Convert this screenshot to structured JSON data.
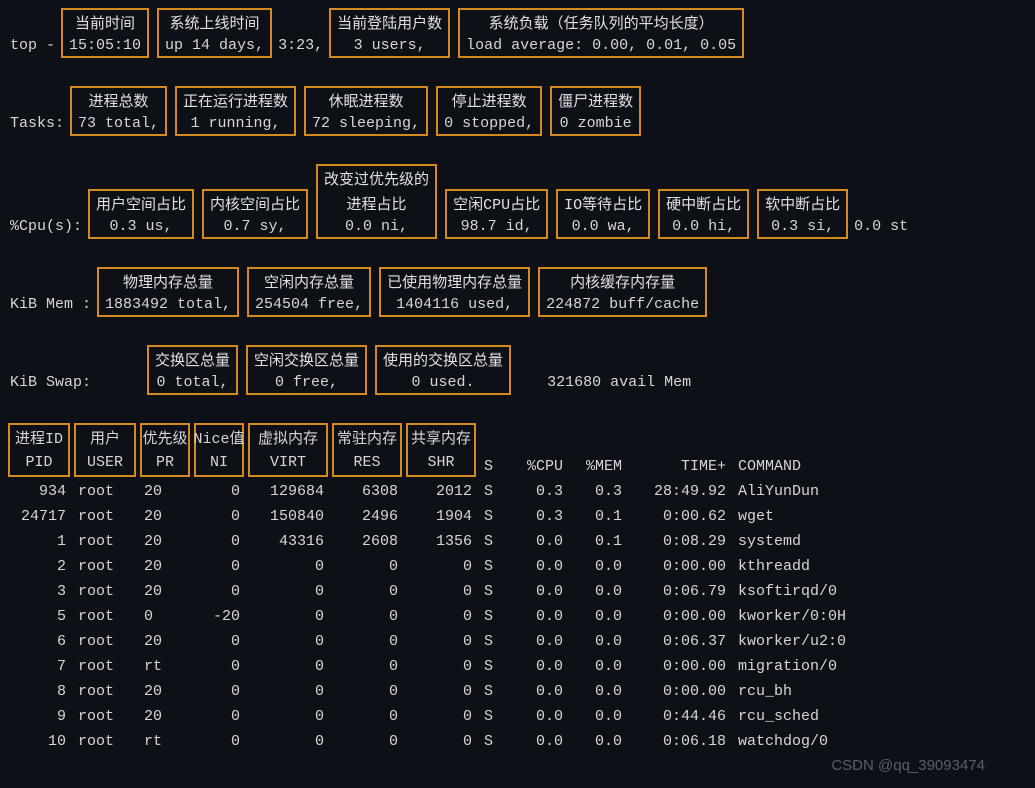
{
  "line1": {
    "prefix": "top -",
    "time_ann": "当前时间",
    "time_val": "15:05:10",
    "uptime_ann": "系统上线时间",
    "uptime_val": "up 14 days,",
    "uptime_extra": "3:23,",
    "users_ann": "当前登陆用户数",
    "users_val": "3 users,",
    "load_ann": "系统负载（任务队列的平均长度）",
    "load_val": "load average: 0.00, 0.01, 0.05"
  },
  "line2": {
    "prefix": "Tasks:",
    "total_ann": "进程总数",
    "total_val": "73 total,",
    "running_ann": "正在运行进程数",
    "running_val": "1 running,",
    "sleeping_ann": "休眠进程数",
    "sleeping_val": "72 sleeping,",
    "stopped_ann": "停止进程数",
    "stopped_val": "0 stopped,",
    "zombie_ann": "僵尸进程数",
    "zombie_val": "0 zombie"
  },
  "line3": {
    "prefix": "%Cpu(s):",
    "us_ann": "用户空间占比",
    "us_val": "0.3 us,",
    "sy_ann": "内核空间占比",
    "sy_val": "0.7 sy,",
    "ni_ann1": "改变过优先级的",
    "ni_ann2": "进程占比",
    "ni_val": "0.0 ni,",
    "id_ann": "空闲CPU占比",
    "id_val": "98.7 id,",
    "wa_ann": "IO等待占比",
    "wa_val": "0.0 wa,",
    "hi_ann": "硬中断占比",
    "hi_val": "0.0 hi,",
    "si_ann": "软中断占比",
    "si_val": "0.3 si,",
    "st_val": "0.0 st"
  },
  "line4": {
    "prefix": "KiB Mem :",
    "total_ann": "物理内存总量",
    "total_val": "1883492 total,",
    "free_ann": "空闲内存总量",
    "free_val": "254504 free,",
    "used_ann": "已使用物理内存总量",
    "used_val": "1404116 used,",
    "cache_ann": "内核缓存内存量",
    "cache_val": "224872 buff/cache"
  },
  "line5": {
    "prefix": "KiB Swap:",
    "total_ann": "交换区总量",
    "total_val": "0 total,",
    "free_ann": "空闲交换区总量",
    "free_val": "0 free,",
    "used_ann": "使用的交换区总量",
    "used_val": "0 used.",
    "avail": "321680 avail Mem"
  },
  "headers": {
    "pid_ann": "进程ID",
    "pid": "PID",
    "user_ann": "用户",
    "user": "USER",
    "pr_ann": "优先级",
    "pr": "PR",
    "ni_ann": "Nice值",
    "ni": "NI",
    "virt_ann": "虚拟内存",
    "virt": "VIRT",
    "res_ann": "常驻内存",
    "res": "RES",
    "shr_ann": "共享内存",
    "shr": "SHR",
    "s": "S",
    "cpu": "%CPU",
    "mem": "%MEM",
    "time": "TIME+",
    "cmd": "COMMAND"
  },
  "rows": [
    {
      "pid": "934",
      "user": "root",
      "pr": "20",
      "ni": "0",
      "virt": "129684",
      "res": "6308",
      "shr": "2012",
      "s": "S",
      "cpu": "0.3",
      "mem": "0.3",
      "time": "28:49.92",
      "cmd": "AliYunDun"
    },
    {
      "pid": "24717",
      "user": "root",
      "pr": "20",
      "ni": "0",
      "virt": "150840",
      "res": "2496",
      "shr": "1904",
      "s": "S",
      "cpu": "0.3",
      "mem": "0.1",
      "time": "0:00.62",
      "cmd": "wget"
    },
    {
      "pid": "1",
      "user": "root",
      "pr": "20",
      "ni": "0",
      "virt": "43316",
      "res": "2608",
      "shr": "1356",
      "s": "S",
      "cpu": "0.0",
      "mem": "0.1",
      "time": "0:08.29",
      "cmd": "systemd"
    },
    {
      "pid": "2",
      "user": "root",
      "pr": "20",
      "ni": "0",
      "virt": "0",
      "res": "0",
      "shr": "0",
      "s": "S",
      "cpu": "0.0",
      "mem": "0.0",
      "time": "0:00.00",
      "cmd": "kthreadd"
    },
    {
      "pid": "3",
      "user": "root",
      "pr": "20",
      "ni": "0",
      "virt": "0",
      "res": "0",
      "shr": "0",
      "s": "S",
      "cpu": "0.0",
      "mem": "0.0",
      "time": "0:06.79",
      "cmd": "ksoftirqd/0"
    },
    {
      "pid": "5",
      "user": "root",
      "pr": "0",
      "ni": "-20",
      "virt": "0",
      "res": "0",
      "shr": "0",
      "s": "S",
      "cpu": "0.0",
      "mem": "0.0",
      "time": "0:00.00",
      "cmd": "kworker/0:0H"
    },
    {
      "pid": "6",
      "user": "root",
      "pr": "20",
      "ni": "0",
      "virt": "0",
      "res": "0",
      "shr": "0",
      "s": "S",
      "cpu": "0.0",
      "mem": "0.0",
      "time": "0:06.37",
      "cmd": "kworker/u2:0"
    },
    {
      "pid": "7",
      "user": "root",
      "pr": "rt",
      "ni": "0",
      "virt": "0",
      "res": "0",
      "shr": "0",
      "s": "S",
      "cpu": "0.0",
      "mem": "0.0",
      "time": "0:00.00",
      "cmd": "migration/0"
    },
    {
      "pid": "8",
      "user": "root",
      "pr": "20",
      "ni": "0",
      "virt": "0",
      "res": "0",
      "shr": "0",
      "s": "S",
      "cpu": "0.0",
      "mem": "0.0",
      "time": "0:00.00",
      "cmd": "rcu_bh"
    },
    {
      "pid": "9",
      "user": "root",
      "pr": "20",
      "ni": "0",
      "virt": "0",
      "res": "0",
      "shr": "0",
      "s": "S",
      "cpu": "0.0",
      "mem": "0.0",
      "time": "0:44.46",
      "cmd": "rcu_sched"
    },
    {
      "pid": "10",
      "user": "root",
      "pr": "rt",
      "ni": "0",
      "virt": "0",
      "res": "0",
      "shr": "0",
      "s": "S",
      "cpu": "0.0",
      "mem": "0.0",
      "time": "0:06.18",
      "cmd": "watchdog/0"
    }
  ],
  "watermark": "CSDN @qq_39093474"
}
